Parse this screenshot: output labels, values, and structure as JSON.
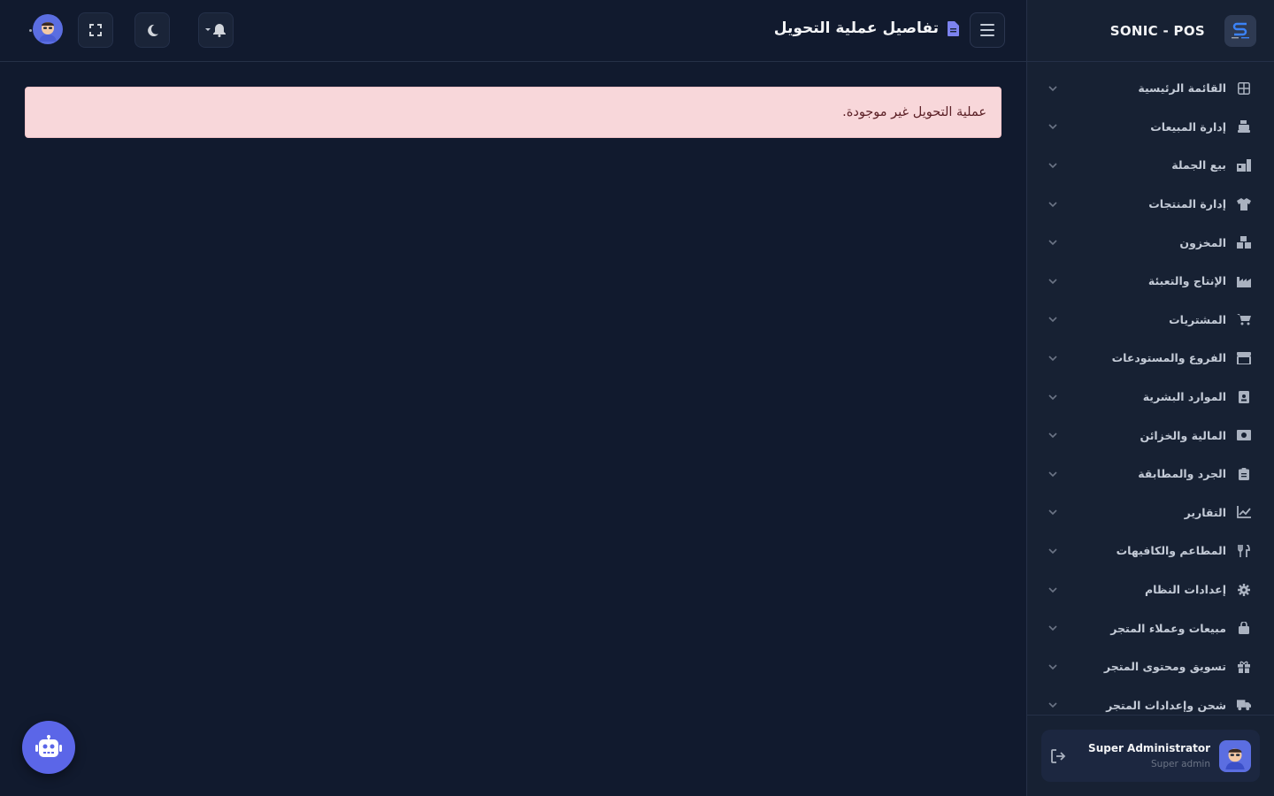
{
  "app": {
    "brand": "SONIC - POS"
  },
  "header": {
    "title": "تفاصيل عملية التحويل"
  },
  "alert": {
    "message": "عملية التحويل غير موجودة."
  },
  "sidebar": {
    "items": [
      {
        "label": "القائمة الرئيسية",
        "icon": "grid-icon"
      },
      {
        "label": "إدارة المبيعات",
        "icon": "cash-register-icon"
      },
      {
        "label": "بيع الجملة",
        "icon": "warehouse-boxes-icon"
      },
      {
        "label": "إدارة المنتجات",
        "icon": "shirt-icon"
      },
      {
        "label": "المخزون",
        "icon": "boxes-icon"
      },
      {
        "label": "الإنتاج والتعبئة",
        "icon": "factory-icon"
      },
      {
        "label": "المشتريات",
        "icon": "cart-icon"
      },
      {
        "label": "الفروع والمستودعات",
        "icon": "store-icon"
      },
      {
        "label": "الموارد البشرية",
        "icon": "id-badge-icon"
      },
      {
        "label": "المالية والخزائن",
        "icon": "money-bill-icon"
      },
      {
        "label": "الجرد والمطابقة",
        "icon": "clipboard-icon"
      },
      {
        "label": "التقارير",
        "icon": "chart-line-icon"
      },
      {
        "label": "المطاعم والكافيهات",
        "icon": "utensils-icon"
      },
      {
        "label": "إعدادات النظام",
        "icon": "gear-icon"
      },
      {
        "label": "مبيعات وعملاء المتجر",
        "icon": "shopping-bag-icon"
      },
      {
        "label": "تسويق ومحتوى المتجر",
        "icon": "gift-icon"
      },
      {
        "label": "شحن وإعدادات المتجر",
        "icon": "truck-icon"
      }
    ]
  },
  "user": {
    "name": "Super Administrator",
    "role": "Super admin"
  },
  "colors": {
    "accent": "#5b66e8",
    "alert_bg": "#f8d7da",
    "alert_text": "#5a1f25",
    "bg": "#111a2e",
    "sidebar_bg": "#172133"
  }
}
